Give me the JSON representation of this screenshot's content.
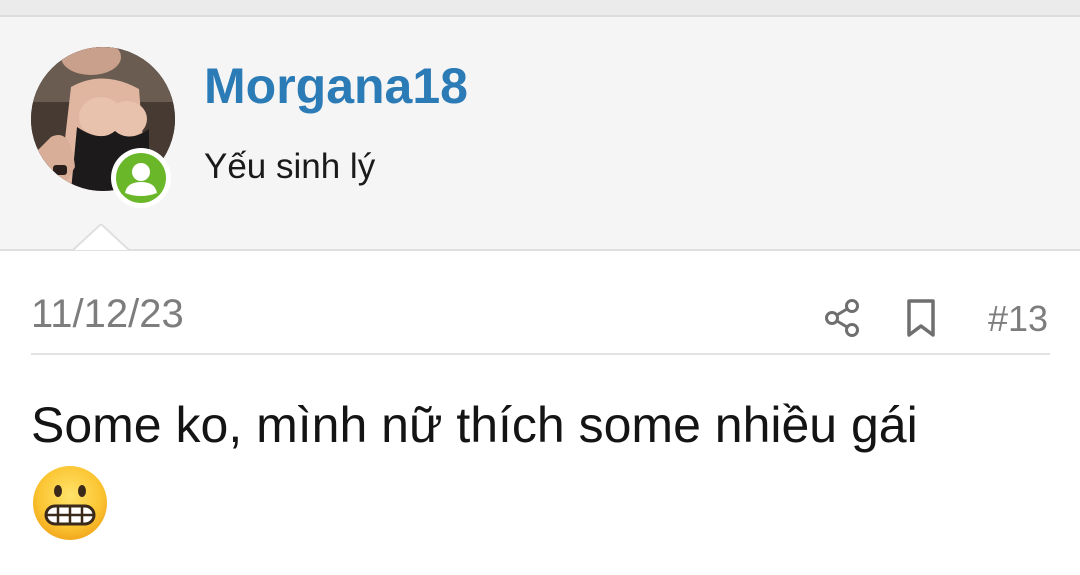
{
  "post": {
    "user": {
      "name": "Morgana18",
      "title": "Yếu sinh lý",
      "avatar_icon": "user-avatar-photo",
      "status_icon": "online-user-icon",
      "status_color": "#6ab82a"
    },
    "date": "11/12/23",
    "number": "#13",
    "actions": {
      "share_icon": "share-icon",
      "bookmark_icon": "bookmark-icon"
    },
    "content": {
      "text": "Some ko, mình nữ thích some nhiều gái",
      "emoji": "grimacing-face-emoji"
    }
  },
  "colors": {
    "username": "#2b7bb7",
    "header_bg": "#f5f5f5",
    "meta_text": "#7d7d7d",
    "icon": "#6f6f6f"
  }
}
